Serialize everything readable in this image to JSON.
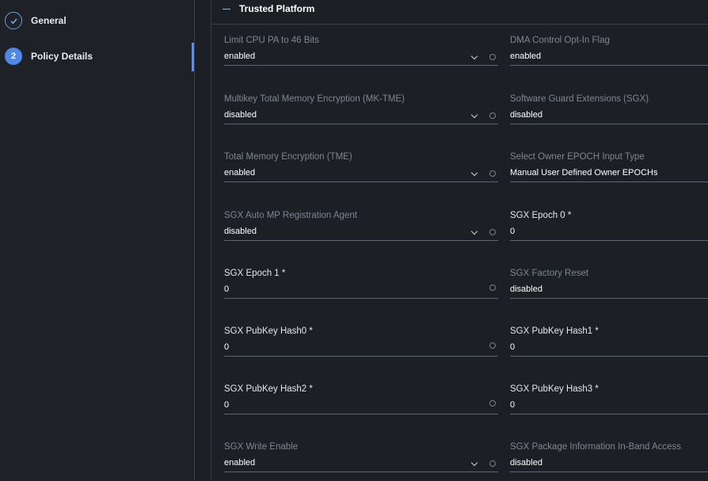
{
  "sidebar": {
    "steps": [
      {
        "label": "General",
        "state": "completed",
        "icon": "check-icon"
      },
      {
        "label": "Policy Details",
        "number": "2",
        "state": "active"
      }
    ]
  },
  "section": {
    "title": "Trusted Platform",
    "collapse_icon": "minus-icon"
  },
  "fields": {
    "limit_cpu_pa": {
      "label": "Limit CPU PA to 46 Bits",
      "value": "enabled"
    },
    "dma_control": {
      "label": "DMA Control Opt-In Flag",
      "value": "enabled"
    },
    "mk_tme": {
      "label": "Multikey Total Memory Encryption (MK-TME)",
      "value": "disabled"
    },
    "sgx": {
      "label": "Software Guard Extensions (SGX)",
      "value": "disabled"
    },
    "tme": {
      "label": "Total Memory Encryption (TME)",
      "value": "enabled"
    },
    "owner_epoch_type": {
      "label": "Select Owner EPOCH Input Type",
      "value": "Manual User Defined Owner EPOCHs"
    },
    "sgx_auto_mp": {
      "label": "SGX Auto MP Registration Agent",
      "value": "disabled"
    },
    "sgx_epoch0": {
      "label": "SGX Epoch 0 *",
      "value": "0"
    },
    "sgx_epoch1": {
      "label": "SGX Epoch 1 *",
      "value": "0"
    },
    "sgx_factory_reset": {
      "label": "SGX Factory Reset",
      "value": "disabled"
    },
    "sgx_pubkey_hash0": {
      "label": "SGX PubKey Hash0 *",
      "value": "0"
    },
    "sgx_pubkey_hash1": {
      "label": "SGX PubKey Hash1 *",
      "value": "0"
    },
    "sgx_pubkey_hash2": {
      "label": "SGX PubKey Hash2 *",
      "value": "0"
    },
    "sgx_pubkey_hash3": {
      "label": "SGX PubKey Hash3 *",
      "value": "0"
    },
    "sgx_write_enable": {
      "label": "SGX Write Enable",
      "value": "enabled"
    },
    "sgx_package_info": {
      "label": "SGX Package Information In-Band Access",
      "value": "disabled"
    }
  },
  "colors": {
    "background": "#1c1f24",
    "accent": "#4f88e8",
    "disabled_label": "#80868f"
  }
}
